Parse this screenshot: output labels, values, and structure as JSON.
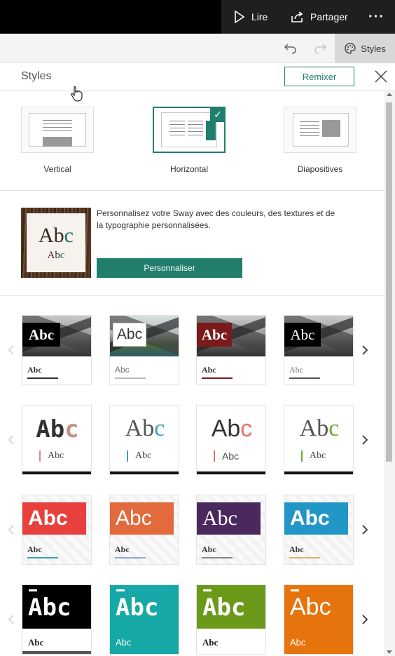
{
  "topbar": {
    "read": "Lire",
    "share": "Partager",
    "more": "···"
  },
  "subbar": {
    "styles_tab": "Styles"
  },
  "panel": {
    "title": "Styles",
    "remix": "Remixer"
  },
  "layouts": [
    {
      "label": "Vertical",
      "selected": false
    },
    {
      "label": "Horizontal",
      "selected": true
    },
    {
      "label": "Diapositives",
      "selected": false
    }
  ],
  "customize": {
    "preview_big": "Ab",
    "preview_big_accent": "c",
    "preview_small": "Ab",
    "preview_small_accent": "c",
    "description": "Personnalisez votre Sway avec des couleurs, des textures et de la typographie personnalisées.",
    "button": "Personnaliser"
  },
  "theme_rows": [
    {
      "tiles": [
        {
          "head": "Abc",
          "sub": "Abc"
        },
        {
          "head": "Abc",
          "sub": "Abc"
        },
        {
          "head": "Abc",
          "sub": "Abc"
        },
        {
          "head": "Abc",
          "sub": "Abc"
        }
      ]
    },
    {
      "tiles": [
        {
          "head": "Ab",
          "accent": "c",
          "sub": "Abc"
        },
        {
          "head": "Ab",
          "accent": "c",
          "sub": "Abc"
        },
        {
          "head": "Ab",
          "accent": "c",
          "sub": "Abc"
        },
        {
          "head": "Ab",
          "accent": "c",
          "sub": "Abc"
        }
      ]
    },
    {
      "tiles": [
        {
          "head": "Abc",
          "sub": "Abc"
        },
        {
          "head": "Abc",
          "sub": "Abc"
        },
        {
          "head": "Abc",
          "sub": "Abc"
        },
        {
          "head": "Abc",
          "sub": "Abc"
        }
      ]
    },
    {
      "tiles": [
        {
          "head": "Abc",
          "sub": "Abc"
        },
        {
          "head": "Abc",
          "sub": "Abc"
        },
        {
          "head": "Abc",
          "sub": "Abc"
        },
        {
          "head": "Abc",
          "sub": "Abc"
        }
      ]
    }
  ],
  "colors": {
    "accent": "#217e6d",
    "row1_heads": [
      "#000000",
      "#ffffff",
      "#7b1a1a",
      "#000000"
    ],
    "row1_underlines": [
      "#333333",
      "#999999",
      "#7b1a1a",
      "#555555"
    ],
    "row2_accents": [
      "#c78f86",
      "#3fa3b8",
      "#e8736e",
      "#6aaa2e"
    ],
    "row3_blocks": [
      "#e8403c",
      "#e36a3c",
      "#4a2a5e",
      "#2196c7"
    ],
    "row4_blocks": [
      "#000000",
      "#15a8a6",
      "#6b9a1b",
      "#e6740d"
    ]
  }
}
